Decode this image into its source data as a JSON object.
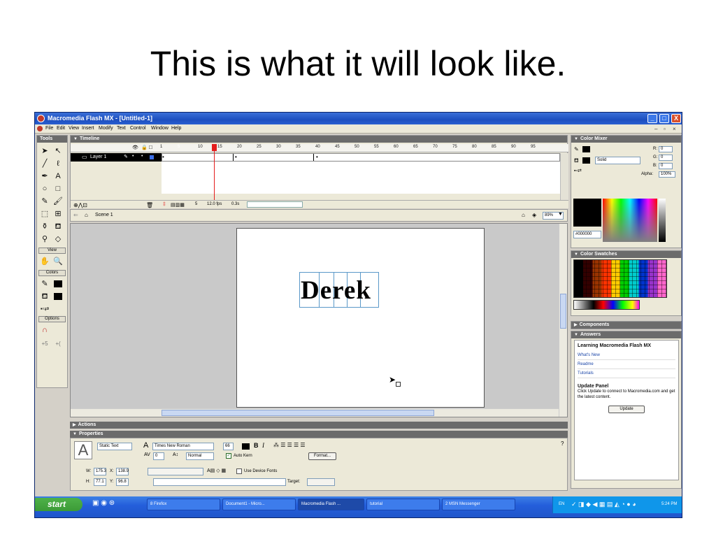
{
  "slide": {
    "title": "This is what it will look like."
  },
  "window": {
    "title": "Macromedia Flash MX - [Untitled-1]",
    "controls": {
      "minimize": "_",
      "maximize": "□",
      "close": "X"
    }
  },
  "menu": [
    "File",
    "Edit",
    "View",
    "Insert",
    "Modify",
    "Text",
    "Control",
    "Window",
    "Help"
  ],
  "tools": {
    "header": "Tools",
    "sections": {
      "view": "View",
      "colors": "Colors",
      "options": "Options"
    }
  },
  "timeline": {
    "header": "Timeline",
    "layer_name": "Layer 1",
    "ticks": [
      "1",
      "5",
      "10",
      "15",
      "20",
      "25",
      "30",
      "35",
      "40",
      "45",
      "50",
      "55",
      "60",
      "65",
      "70",
      "75",
      "80",
      "85",
      "90",
      "95"
    ],
    "current_frame": "5",
    "fps": "12.0 fps",
    "time": "0.3s"
  },
  "scene": {
    "name": "Scene 1",
    "zoom": "89%"
  },
  "stage": {
    "text": "Derek"
  },
  "panels": {
    "actions": "Actions",
    "properties": "Properties"
  },
  "properties": {
    "text_type": "Static Text",
    "font": "Times New Roman",
    "size": "66",
    "bold": "B",
    "italic": "I",
    "tracking": "0",
    "baseline": "Normal",
    "auto_kern": "Auto Kern",
    "format_button": "Format...",
    "w_label": "W:",
    "w": "175.3",
    "x_label": "X:",
    "x": "138.9",
    "h_label": "H:",
    "h": "77.1",
    "y_label": "Y:",
    "y": "96.8",
    "device_fonts": "Use Device Fonts",
    "target_label": "Target:"
  },
  "color_mixer": {
    "header": "Color Mixer",
    "fill_type": "Solid",
    "r_label": "R:",
    "r": "0",
    "g_label": "G:",
    "g": "0",
    "b_label": "B:",
    "b": "0",
    "alpha_label": "Alpha:",
    "alpha": "100%",
    "hex": "#000000"
  },
  "color_swatches": {
    "header": "Color Swatches"
  },
  "components": {
    "header": "Components"
  },
  "answers": {
    "header": "Answers",
    "title": "Learning Macromedia Flash MX",
    "links": [
      "What's New",
      "Readme",
      "Tutorials"
    ],
    "update_title": "Update Panel",
    "update_desc": "Click Update to connect to Macromedia.com and get the latest content.",
    "update_button": "Update"
  },
  "taskbar": {
    "start": "start",
    "tasks": [
      "8 Firefox",
      "Document1 - Micro...",
      "Macromedia Flash ...",
      "tutorial",
      "2 MSN Messenger"
    ],
    "lang": "EN",
    "clock": "5:24 PM"
  },
  "colors": {
    "titlebar": "#1d4fbf",
    "panel_header": "#6b6b6b",
    "stage_bg": "#ffffff",
    "playhead": "#e41c1c",
    "start_button": "#3c9a37"
  }
}
